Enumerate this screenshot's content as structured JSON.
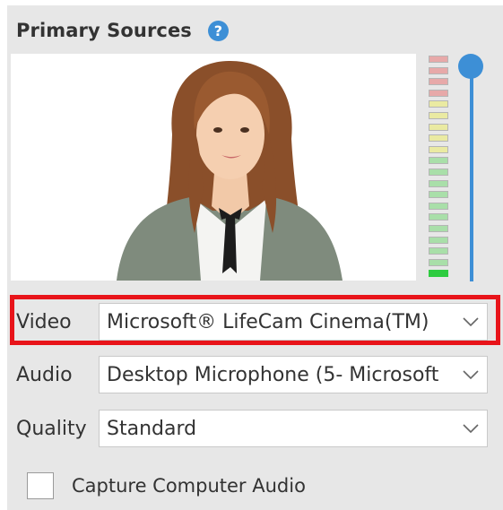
{
  "section": {
    "title": "Primary Sources",
    "help_icon": "question-circle-icon",
    "help_glyph": "?"
  },
  "preview": {
    "icon": "webcam-preview-image"
  },
  "audio_meter": {
    "segments_total": 20,
    "segments_active": 1,
    "colors": {
      "red": "#e7a9a9",
      "yellow": "#eaeaa2",
      "green": "#a9dfa9",
      "active": "#2ecc40"
    }
  },
  "volume_slider": {
    "level": 1.0,
    "accent": "#3d8fd6"
  },
  "fields": {
    "video": {
      "label": "Video",
      "value": "Microsoft® LifeCam Cinema(TM)"
    },
    "audio": {
      "label": "Audio",
      "value": "Desktop Microphone (5- Microsoft"
    },
    "quality": {
      "label": "Quality",
      "value": "Standard"
    }
  },
  "capture_audio": {
    "label": "Capture Computer Audio",
    "checked": false
  },
  "highlight_color": "#e8141a"
}
